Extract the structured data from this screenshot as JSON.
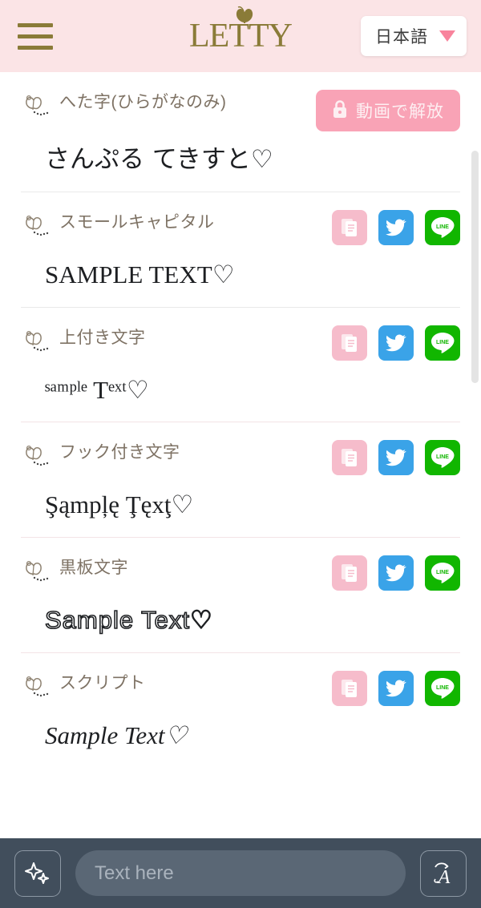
{
  "header": {
    "menu_icon": "hamburger-icon",
    "logo_text": "LETTY",
    "logo_icon": "butterfly-icon",
    "language": {
      "selected": "日本語",
      "caret_icon": "chevron-down-icon"
    }
  },
  "colors": {
    "header_bg": "#fbe4e6",
    "logo": "#8a7b38",
    "accent_pink": "#f8839c",
    "copy_btn": "#f6bccb",
    "twitter_btn": "#3aa3e8",
    "line_btn": "#11b600",
    "unlock_btn": "#f9a3b6",
    "bottom_bar": "#414e5c",
    "input_bg": "#5a6775"
  },
  "actions": {
    "copy_label": "copy-icon",
    "twitter_label": "twitter-icon",
    "line_label": "line-icon",
    "unlock_label": "動画で解放",
    "lock_icon": "lock-icon"
  },
  "rows": [
    {
      "label": "へた字(ひらがなのみ)",
      "sample": "さんぷる てきすと♡",
      "locked": true
    },
    {
      "label": "スモールキャピタル",
      "sample": "SAMPLE TEXT♡",
      "locked": false
    },
    {
      "label": "上付き文字",
      "sample": "ˢᵃᵐᵖˡᵉ Tᵉˣᵗ♡",
      "locked": false
    },
    {
      "label": "フック付き文字",
      "sample": "Şąmpļę Ţęxţ♡",
      "locked": false
    },
    {
      "label": "黒板文字",
      "sample": "Sample Text♡",
      "locked": false
    },
    {
      "label": "スクリプト",
      "sample": "Sample Text♡",
      "locked": false
    }
  ],
  "bottom": {
    "sparkle_icon": "sparkles-icon",
    "input_placeholder": "Text here",
    "input_value": "",
    "font_icon": "script-a-icon"
  }
}
